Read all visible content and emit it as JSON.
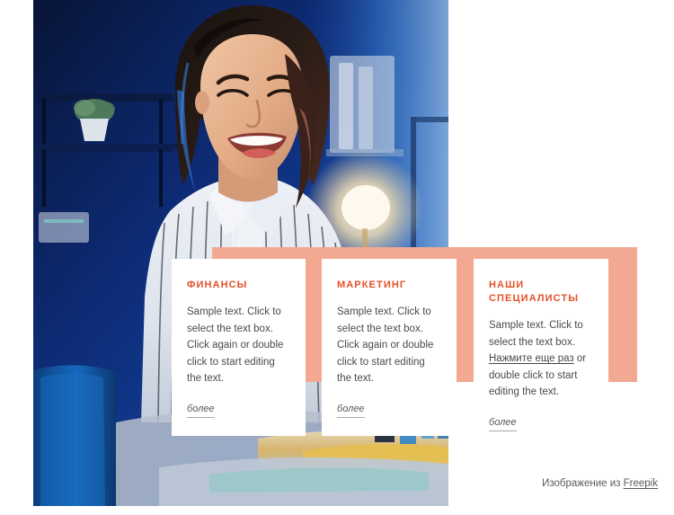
{
  "theme": {
    "accent_peach": "#f2a891",
    "heading_orange": "#e3512a",
    "body_gray": "#4a4a4a",
    "page_background": "#ffffff"
  },
  "hero": {
    "image_name": "smiling-woman-in-striped-shirt-office-blue-light",
    "alt": "Smiling young woman in a striped shirt in a blue-lit office"
  },
  "cards": [
    {
      "title": "ФИНАНСЫ",
      "body": "Sample text. Click to select the text box. Click again or double click to start editing the text.",
      "link_label": "более"
    },
    {
      "title": "МАРКЕТИНГ",
      "body": "Sample text. Click to select the text box. Click again or double click to start editing the text.",
      "link_label": "более"
    },
    {
      "title": "НАШИ СПЕЦИАЛИСТЫ",
      "body_before": "Sample text. Click to select the text box. ",
      "body_link": "Нажмите еще раз",
      "body_after": " or double click to start editing the text.",
      "link_label": "более"
    }
  ],
  "credit": {
    "prefix": "Изображение из ",
    "source": "Freepik"
  }
}
